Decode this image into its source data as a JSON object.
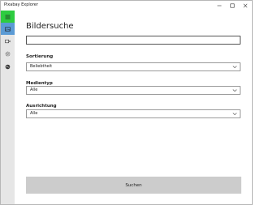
{
  "window": {
    "title": "Pixabay Explorer"
  },
  "sidebar": {
    "items": [
      {
        "icon": "menu-icon",
        "active": true,
        "color": "#2ecc40"
      },
      {
        "icon": "image-icon",
        "active": true,
        "color": "#5b9bd5"
      },
      {
        "icon": "video-icon",
        "active": false
      },
      {
        "icon": "gear-icon",
        "active": false
      },
      {
        "icon": "globe-icon",
        "active": false
      }
    ]
  },
  "main": {
    "title": "Bildersuche",
    "search": {
      "value": "",
      "placeholder": ""
    },
    "sorting": {
      "label": "Sortierung",
      "value": "Beliebtheit"
    },
    "media_type": {
      "label": "Medientyp",
      "value": "Alle"
    },
    "orientation": {
      "label": "Ausrichtung",
      "value": "Alle"
    },
    "search_button": "Suchen"
  },
  "colors": {
    "accent_green": "#2ecc40",
    "accent_blue": "#5b9bd5",
    "button_bg": "#cccccc"
  }
}
